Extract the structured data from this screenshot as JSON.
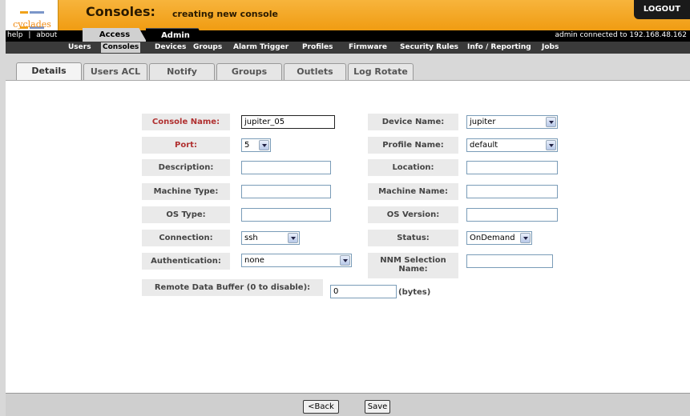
{
  "header": {
    "logo_text": "cyclades",
    "title": "Consoles:",
    "subtitle": "creating new console",
    "logout_label": "LOGOUT"
  },
  "topbar": {
    "help": "help",
    "separator": "|",
    "about": "about",
    "connection_info": "admin connected to 192.168.48.162",
    "tabs": [
      "Access",
      "Admin"
    ]
  },
  "subnav": [
    "Users",
    "Consoles",
    "Devices",
    "Groups",
    "Alarm Trigger",
    "Profiles",
    "Firmware",
    "Security Rules",
    "Info / Reporting",
    "Jobs"
  ],
  "detail_tabs": [
    "Details",
    "Users ACL",
    "Notify",
    "Groups",
    "Outlets",
    "Log Rotate"
  ],
  "form": {
    "console_name_label": "Console Name:",
    "console_name_value": "jupiter_05",
    "device_name_label": "Device Name:",
    "device_name_value": "jupiter",
    "port_label": "Port:",
    "port_value": "5",
    "profile_name_label": "Profile Name:",
    "profile_name_value": "default",
    "description_label": "Description:",
    "location_label": "Location:",
    "machine_type_label": "Machine Type:",
    "machine_name_label": "Machine Name:",
    "os_type_label": "OS Type:",
    "os_version_label": "OS Version:",
    "connection_label": "Connection:",
    "connection_value": "ssh",
    "status_label": "Status:",
    "status_value": "OnDemand",
    "authentication_label": "Authentication:",
    "authentication_value": "none",
    "nnm_label_line1": "NNM Selection",
    "nnm_label_line2": "Name:",
    "remote_buffer_label": "Remote Data Buffer (0 to disable):",
    "remote_buffer_value": "0",
    "remote_buffer_unit": "(bytes)"
  },
  "footer": {
    "back_label": "<Back",
    "save_label": "Save"
  },
  "colors": {
    "header_orange": "#f09c12",
    "required_label": "#b03030"
  }
}
